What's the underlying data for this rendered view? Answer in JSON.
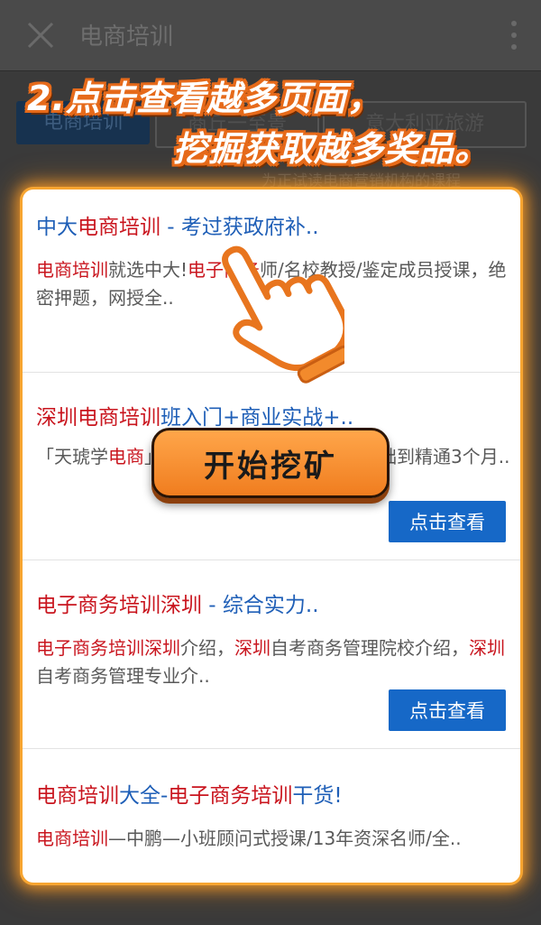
{
  "app_bar": {
    "title": "电商培训",
    "icons": {
      "close": "close-icon",
      "more": "more-vertical-icon"
    }
  },
  "background_chips": [
    "电商培训",
    "商丘一至景",
    "意大利亚旅游"
  ],
  "background_subtext": "为正试读电商营销机构的课程",
  "instruction": {
    "line1": "2.点击查看越多页面，",
    "line2": "挖掘获取越多奖品。",
    "text_color": "#ffffff",
    "outline_color": "#e66a1a"
  },
  "results": [
    {
      "title_parts": [
        {
          "text": "中大",
          "hl": false
        },
        {
          "text": "电商培训",
          "hl": true
        },
        {
          "text": " - 考过获政府补..",
          "hl": false
        }
      ],
      "desc_parts": [
        {
          "text": "电商培训",
          "hl": true
        },
        {
          "text": "就选中大!",
          "hl": false
        },
        {
          "text": "电子商务",
          "hl": true
        },
        {
          "text": "师/名校教授/鉴定成员授课，绝密押题，网授全..",
          "hl": false
        }
      ],
      "button": ""
    },
    {
      "title_parts": [
        {
          "text": "深圳电商培训",
          "hl": true
        },
        {
          "text": "班入门+商业实战+..",
          "hl": false
        }
      ],
      "desc_parts": [
        {
          "text": "「天琥学",
          "hl": false
        },
        {
          "text": "电商",
          "hl": true
        },
        {
          "text": "」全程项目实战性教学，零基础到精通3个月..",
          "hl": false
        }
      ],
      "button": "点击查看"
    },
    {
      "title_parts": [
        {
          "text": "电子商务培训深圳",
          "hl": true
        },
        {
          "text": " - 综合实力..",
          "hl": false
        }
      ],
      "desc_parts": [
        {
          "text": "电子商务培训深圳",
          "hl": true
        },
        {
          "text": "介绍，",
          "hl": false
        },
        {
          "text": "深圳",
          "hl": true
        },
        {
          "text": "自考商务管理院校介绍，",
          "hl": false
        },
        {
          "text": "深圳",
          "hl": true
        },
        {
          "text": "自考商务管理专业介..",
          "hl": false
        }
      ],
      "button": "点击查看"
    },
    {
      "title_parts": [
        {
          "text": "电商培训",
          "hl": true
        },
        {
          "text": "大全-",
          "hl": false
        },
        {
          "text": "电子商务培训",
          "hl": true
        },
        {
          "text": "干货!",
          "hl": false
        }
      ],
      "desc_parts": [
        {
          "text": "电商培训",
          "hl": true
        },
        {
          "text": "—中鹏—小班顾问式授课/13年资深名师/全..",
          "hl": false
        }
      ],
      "button": ""
    }
  ],
  "start_button": {
    "label": "开始挖矿",
    "color": "#f58a2a"
  },
  "pointer": {
    "icon": "hand-pointer-icon"
  },
  "colors": {
    "highlight": "#c9151e",
    "link": "#1f5fb7",
    "button": "#1668c7",
    "glow": "#f7a531"
  }
}
